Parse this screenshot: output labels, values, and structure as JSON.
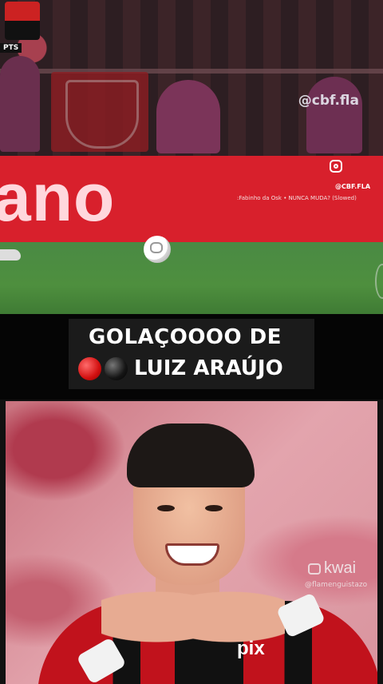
{
  "video": {
    "score_badge": "PTS",
    "watermark_handle": "@cbf.fla",
    "ad_text": "ano",
    "instagram_handle": "@CBF.FLA",
    "music_text": ":Fabinho da Osk • NUNCA MUDA? (Slowed)"
  },
  "caption": {
    "line1": "GOLAÇOOOO DE",
    "line2_name": "LUIZ ARAÚJO",
    "emojis": [
      "red-circle",
      "black-circle"
    ]
  },
  "photo": {
    "sponsor": "pix",
    "app_watermark": "kwai",
    "app_user": "@flamenguistazo"
  },
  "colors": {
    "ad_board": "#d8202c",
    "caption_bg": "#1b1b1b",
    "band_bg": "#050505",
    "flamengo_red": "#c1121c"
  }
}
